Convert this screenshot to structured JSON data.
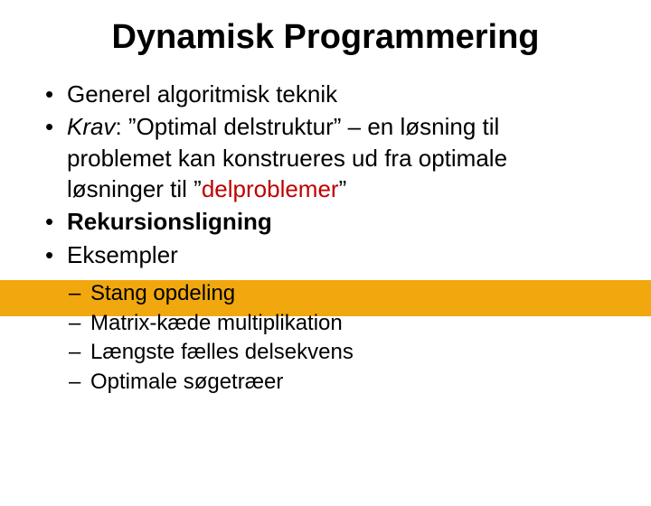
{
  "title": "Dynamisk Programmering",
  "bullets": {
    "b1": {
      "text": "Generel algoritmisk teknik"
    },
    "b2": {
      "lead": "Krav",
      "sep": ": ",
      "q1": "”Optimal delstruktur” – en løsning til problemet kan konstrueres ud fra optimale løsninger til ”",
      "red": "delproblemer",
      "q2": "”"
    },
    "b3": {
      "text": "Rekursionsligning"
    },
    "b4": {
      "text": "Eksempler"
    }
  },
  "sub": {
    "s1": "Stang opdeling",
    "s2": "Matrix-kæde multiplikation",
    "s3": "Længste fælles delsekvens",
    "s4": "Optimale søgetræer"
  },
  "glyphs": {
    "bullet": "•",
    "dash": "–"
  }
}
